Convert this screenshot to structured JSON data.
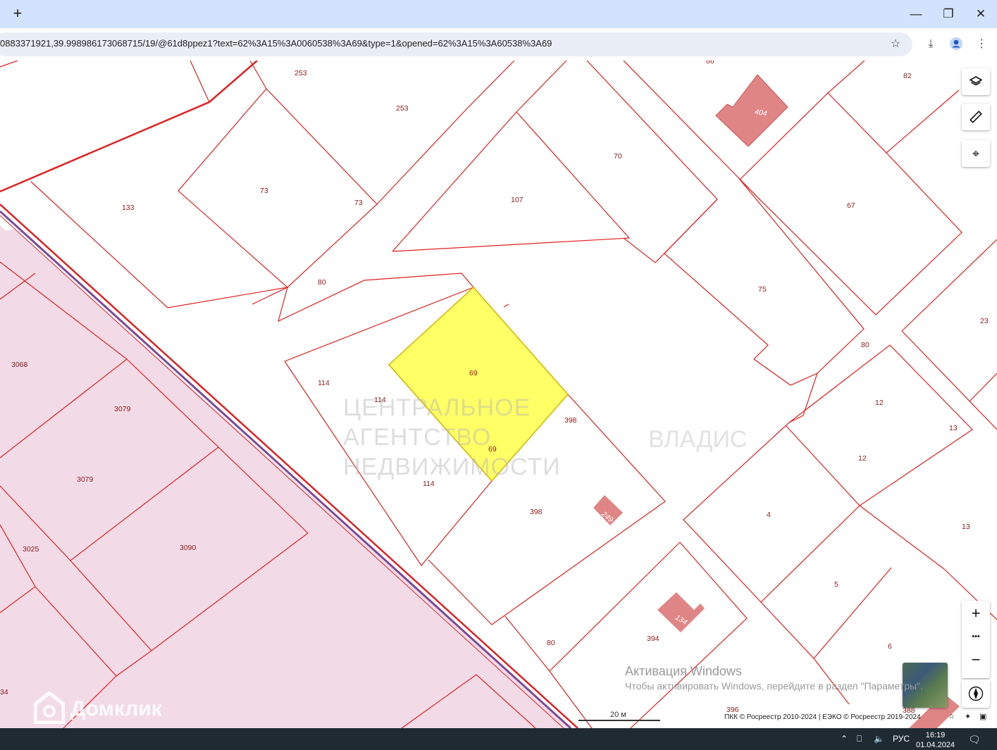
{
  "browser": {
    "new_tab_glyph": "+",
    "url": "0883371921,39.998986173068715/19/@61d8ppez1?text=62%3A15%3A0060538%3A69&type=1&opened=62%3A15%3A60538%3A69",
    "icons": [
      "bookmark-star-icon",
      "download-icon",
      "profile-icon",
      "menu-icon",
      "minimize-icon",
      "restore-icon",
      "close-icon"
    ]
  },
  "map": {
    "selected_parcel": {
      "labels": [
        "69",
        "69"
      ],
      "color": "#ffff66",
      "border": "#d4b400"
    },
    "parcel_labels": [
      "253",
      "253",
      "133",
      "73",
      "73",
      "80",
      "107",
      "70",
      "404",
      "82",
      "67",
      "75",
      "23",
      "80",
      "114",
      "114",
      "114",
      "398",
      "398",
      "249",
      "12",
      "12",
      "13",
      "4",
      "13",
      "5",
      "6",
      "80",
      "394",
      "134",
      "396",
      "388",
      "3068",
      "3079",
      "3079",
      "3025",
      "3090",
      "34"
    ],
    "scale_label": "20 м",
    "copyright": "ПКК © Росреестр 2010-2024 | ЕЭКО © Росреестр 2019-2024",
    "watermark_agency_lines": [
      "ЦЕНТРАЛЬНОЕ",
      "АГЕНТСТВО",
      "НЕДВИЖИМОСТИ"
    ],
    "watermark_right": "ВЛАДИС",
    "domclick": "Домклик",
    "windows_activation_title": "Активация Windows",
    "windows_activation_text": "Чтобы активировать Windows, перейдите в раздел \"Параметры\".",
    "controls": [
      "layers-icon",
      "ruler-icon",
      "locate-icon",
      "zoom-in-icon",
      "more-icon",
      "zoom-out-icon",
      "compass-icon"
    ],
    "zoom_in": "+",
    "more": "•••",
    "zoom_out": "−",
    "colors": {
      "boundary": "#e0201f",
      "building": "#e08585",
      "pink_zone": "#f2dbe7"
    }
  },
  "taskbar": {
    "lang": "РУС",
    "time": "16:19",
    "date": "01.04.2024"
  }
}
